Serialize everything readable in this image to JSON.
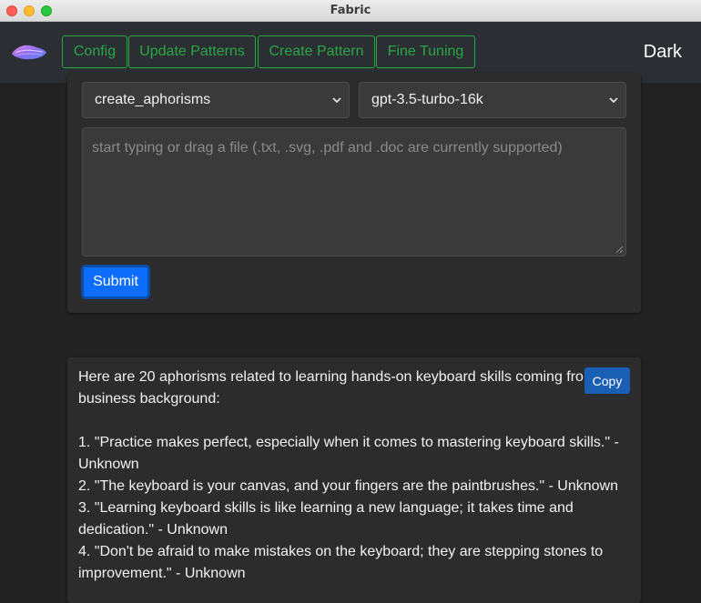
{
  "window": {
    "title": "Fabric"
  },
  "nav": {
    "buttons": [
      "Config",
      "Update Patterns",
      "Create Pattern",
      "Fine Tuning"
    ],
    "theme_label": "Dark"
  },
  "form": {
    "pattern_select": "create_aphorisms",
    "model_select": "gpt-3.5-turbo-16k",
    "input_placeholder": "start typing or drag a file (.txt, .svg, .pdf and .doc are currently supported)",
    "submit_label": "Submit"
  },
  "response": {
    "copy_label": "Copy",
    "text": "Here are 20 aphorisms related to learning hands-on keyboard skills coming from a\nbusiness background:\n\n1. \"Practice makes perfect, especially when it comes to mastering keyboard skills.\" -\nUnknown\n2. \"The keyboard is your canvas, and your fingers are the paintbrushes.\" - Unknown\n3. \"Learning keyboard skills is like learning a new language; it takes time and\ndedication.\" - Unknown\n4. \"Don't be afraid to make mistakes on the keyboard; they are stepping stones to\nimprovement.\" - Unknown"
  },
  "colors": {
    "accent_green": "#28a745",
    "submit_blue": "#0d6efd",
    "copy_blue": "#1b5fb5",
    "background": "#222222"
  }
}
